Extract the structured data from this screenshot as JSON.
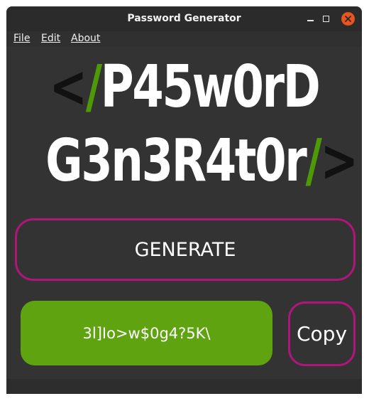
{
  "window": {
    "title": "Password Generator"
  },
  "menu": {
    "file": "File",
    "edit": "Edit",
    "about": "About"
  },
  "logo": {
    "line1": {
      "open": "<",
      "slash": "/",
      "text": "P45w0rD"
    },
    "line2": {
      "text": "G3n3R4t0r",
      "slash": "/",
      "close": ">"
    }
  },
  "generate_label": "GENERATE",
  "password_value": "3l]Io>w$0g4?5K\\",
  "copy_label": "Copy",
  "colors": {
    "accent_border": "#b0157a",
    "password_bg": "#5fa311",
    "logo_green": "#4e9a06",
    "close_button": "#e95420"
  }
}
